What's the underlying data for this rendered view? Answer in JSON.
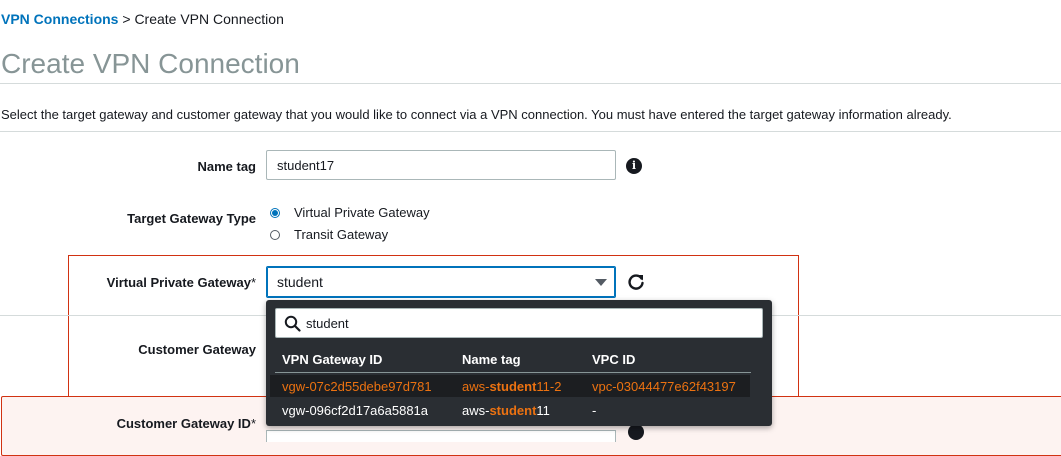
{
  "breadcrumb": {
    "parent": "VPN Connections",
    "separator": ">",
    "current": "Create VPN Connection"
  },
  "page": {
    "title": "Create VPN Connection",
    "description": "Select the target gateway and customer gateway that you would like to connect via a VPN connection. You must have entered the target gateway information already."
  },
  "form": {
    "name_tag": {
      "label": "Name tag",
      "value": "student17"
    },
    "target_gateway_type": {
      "label": "Target Gateway Type",
      "options": [
        {
          "label": "Virtual Private Gateway",
          "selected": true
        },
        {
          "label": "Transit Gateway",
          "selected": false
        }
      ]
    },
    "virtual_private_gateway": {
      "label": "Virtual Private Gateway",
      "required_mark": "*",
      "value": "student"
    },
    "customer_gateway": {
      "label": "Customer Gateway"
    },
    "customer_gateway_id": {
      "label": "Customer Gateway ID",
      "required_mark": "*"
    }
  },
  "dropdown": {
    "search_value": "student",
    "columns": [
      "VPN Gateway ID",
      "Name tag",
      "VPC ID"
    ],
    "rows": [
      {
        "id": "vgw-07c2d55debe97d781",
        "name_prefix": "aws-",
        "name_match": "student",
        "name_suffix": "11-2",
        "vpc": "vpc-03044477e62f43197",
        "highlighted": true
      },
      {
        "id": "vgw-096cf2d17a6a5881a",
        "name_prefix": "aws-",
        "name_match": "student",
        "name_suffix": "11",
        "vpc": "-",
        "highlighted": false
      }
    ]
  },
  "colors": {
    "link": "#0073bb",
    "error": "#d13212",
    "highlight": "#ec7211",
    "dropdown_bg": "#2a2e33"
  },
  "icons": [
    "info-icon",
    "caret-down-icon",
    "refresh-icon",
    "search-icon"
  ]
}
